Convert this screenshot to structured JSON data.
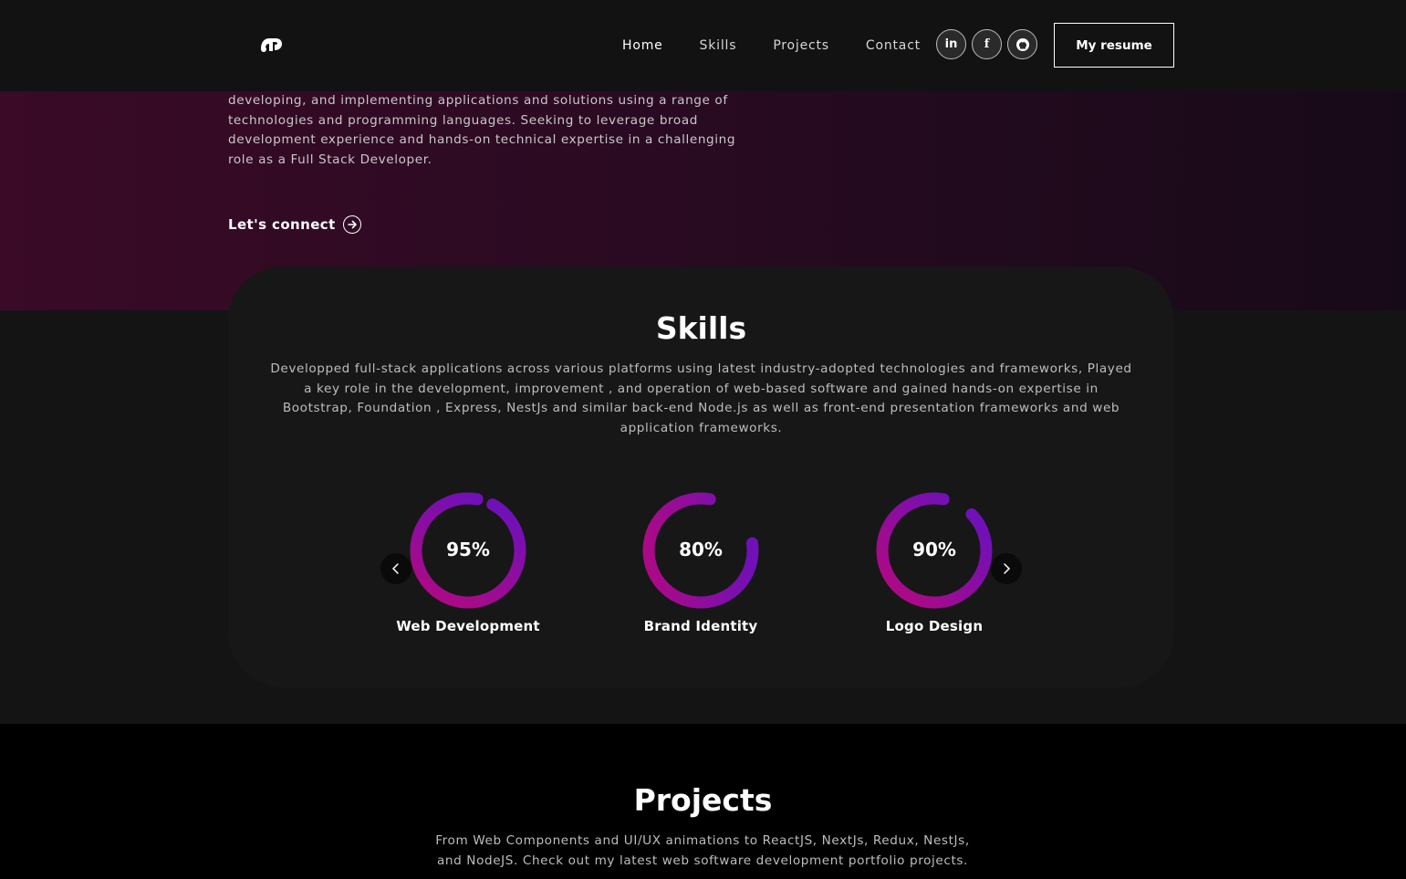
{
  "nav": {
    "links": [
      {
        "label": "Home"
      },
      {
        "label": "Skills"
      },
      {
        "label": "Projects"
      },
      {
        "label": "Contact"
      }
    ],
    "socials": [
      {
        "icon": "linkedin-icon",
        "glyph": "in"
      },
      {
        "icon": "facebook-icon",
        "glyph": "f"
      },
      {
        "icon": "github-icon",
        "glyph": ""
      }
    ],
    "resume_label": "My resume"
  },
  "banner": {
    "text": "developing, and implementing applications and solutions using a range of technologies and programming languages. Seeking to leverage broad development experience and hands-on technical expertise in a challenging role as a Full Stack Developer.",
    "connect_label": "Let's connect"
  },
  "skills": {
    "title": "Skills",
    "description": "Developped full-stack applications across various platforms using latest industry-adopted technologies and frameworks, Played a key role in the development, improvement , and operation of web-based software and gained hands-on expertise in Bootstrap, Foundation , Express, NestJs and similar back-end Node.js as well as front-end presentation frameworks and web application frameworks.",
    "items": [
      {
        "percent": 95,
        "percent_label": "95%",
        "name": "Web Development"
      },
      {
        "percent": 80,
        "percent_label": "80%",
        "name": "Brand Identity"
      },
      {
        "percent": 90,
        "percent_label": "90%",
        "name": "Logo Design"
      }
    ],
    "gradient_colors": [
      "#aa0a87",
      "#6f10b8"
    ]
  },
  "projects": {
    "title": "Projects",
    "description": "From Web Components and UI/UX animations to ReactJS, NextJs, Redux, NestJs, and NodeJS. Check out my latest web software development portfolio projects."
  },
  "colors": {
    "navbar_bg": "#121212",
    "card_bg": "#171717",
    "accent": "#aa0a87"
  }
}
